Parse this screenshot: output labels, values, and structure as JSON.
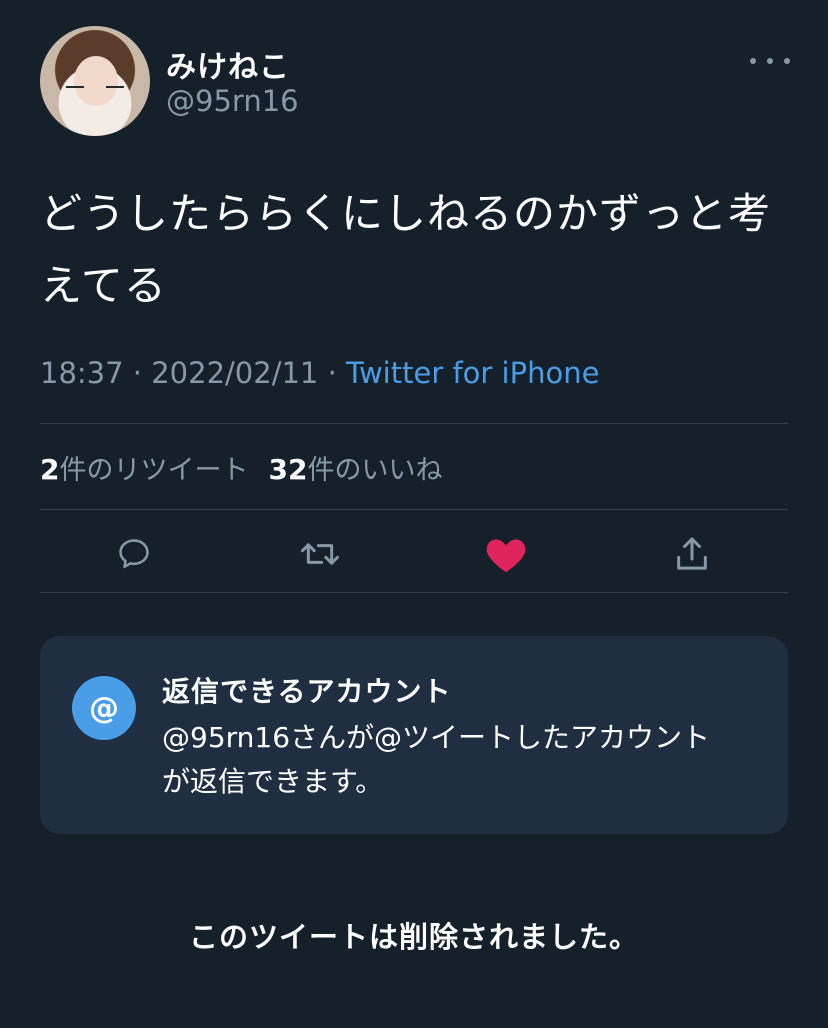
{
  "user": {
    "display_name": "みけねこ",
    "handle": "@95rn16"
  },
  "tweet": {
    "line1": "どうしたららくにしねるのかずっと考",
    "line2": "えてる",
    "time": "18:37",
    "separator": "·",
    "date": "2022/02/11",
    "source": "Twitter for iPhone"
  },
  "stats": {
    "retweets_count": "2",
    "retweets_label": "件のリツイート",
    "likes_count": "32",
    "likes_label": "件のいいね"
  },
  "actions": {
    "reply_icon": "reply-icon",
    "retweet_icon": "retweet-icon",
    "like_icon": "heart-icon",
    "like_color": "#e0245e",
    "share_icon": "share-icon"
  },
  "reply_info": {
    "badge": "@",
    "title": "返信できるアカウント",
    "line1": "@95rn16さんが@ツイートしたアカウント",
    "line2": "が返信できます。"
  },
  "deleted_notice": "このツイートは削除されました。",
  "colors": {
    "background": "#15202b",
    "secondary_text": "#8899a6",
    "link": "#4a9ee8",
    "card": "#1f2f41"
  }
}
